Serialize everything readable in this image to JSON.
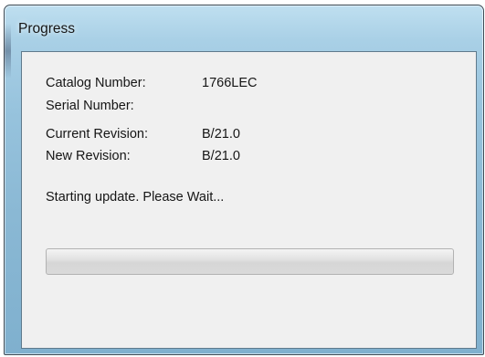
{
  "window": {
    "title": "Progress"
  },
  "fields": [
    {
      "label": "Catalog Number:",
      "value": "1766LEC"
    },
    {
      "label": "Serial Number:",
      "value": ""
    },
    {
      "label": "Current Revision:",
      "value": "B/21.0"
    },
    {
      "label": "New Revision:",
      "value": "B/21.0"
    }
  ],
  "status": {
    "message": "Starting update. Please Wait..."
  },
  "progress": {
    "fraction": 0
  }
}
